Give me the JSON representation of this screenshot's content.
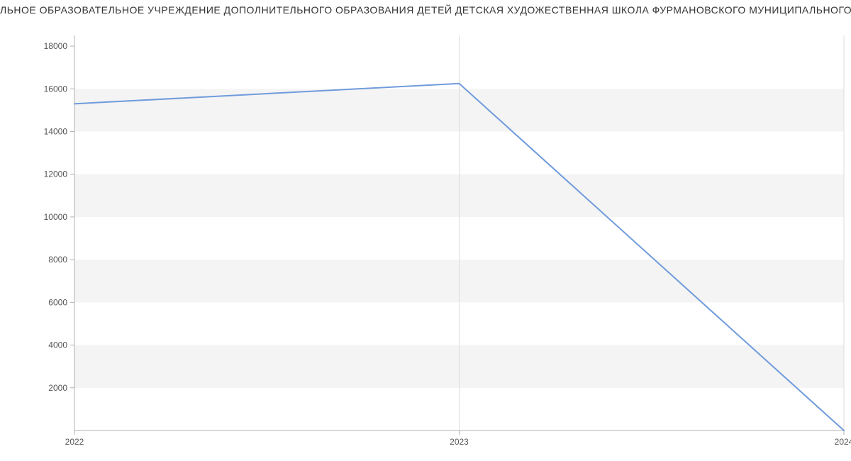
{
  "chart_data": {
    "type": "line",
    "title": "ЛЬНОЕ ОБРАЗОВАТЕЛЬНОЕ УЧРЕЖДЕНИЕ ДОПОЛНИТЕЛЬНОГО ОБРАЗОВАНИЯ ДЕТЕЙ ДЕТСКАЯ ХУДОЖЕСТВЕННАЯ ШКОЛА ФУРМАНОВСКОГО МУНИЦИПАЛЬНОГО РАЙОН",
    "xlabel": "",
    "ylabel": "",
    "x": [
      2022,
      2023,
      2024
    ],
    "values": [
      15300,
      16250,
      0
    ],
    "x_ticks": [
      2022,
      2023,
      2024
    ],
    "y_ticks": [
      2000,
      4000,
      6000,
      8000,
      10000,
      12000,
      14000,
      16000,
      18000
    ],
    "ylim": [
      0,
      18500
    ],
    "xlim": [
      2022,
      2024
    ],
    "line_color": "#6f9bdc",
    "grid_band_color": "#f4f4f4"
  }
}
